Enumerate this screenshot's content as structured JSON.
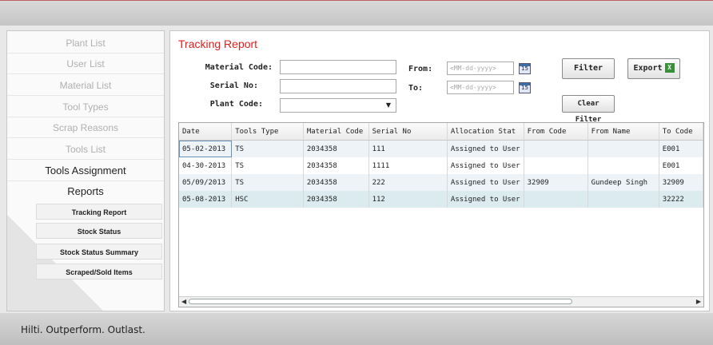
{
  "footer": {
    "tagline": "Hilti. Outperform. Outlast."
  },
  "sidebar": {
    "items": [
      {
        "label": "Plant List"
      },
      {
        "label": "User List"
      },
      {
        "label": "Material List"
      },
      {
        "label": "Tool Types"
      },
      {
        "label": "Scrap Reasons"
      },
      {
        "label": "Tools List"
      },
      {
        "label": "Tools Assignment"
      },
      {
        "label": "Reports"
      }
    ],
    "sub_items": [
      {
        "label": "Tracking Report"
      },
      {
        "label": "Stock Status"
      },
      {
        "label": "Stock Status Summary"
      },
      {
        "label": "Scraped/Sold Items"
      }
    ]
  },
  "main": {
    "title": "Tracking Report",
    "form": {
      "material_code_label": "Material Code:",
      "serial_no_label": "Serial No:",
      "plant_code_label": "Plant Code:",
      "from_label": "From:",
      "to_label": "To:",
      "from_placeholder": "<MM-dd-yyyy>",
      "to_placeholder": "<MM-dd-yyyy>",
      "calendar_day": "15"
    },
    "buttons": {
      "filter": "Filter",
      "export": "Export",
      "clear_filter": "Clear Filter"
    },
    "grid": {
      "columns": [
        "Date",
        "Tools Type",
        "Material Code",
        "Serial No",
        "Allocation Stat",
        "From Code",
        "From Name",
        "To Code"
      ],
      "rows": [
        [
          "05-02-2013",
          "TS",
          "2034358",
          "111",
          "Assigned to User",
          "",
          "",
          "E001"
        ],
        [
          "04-30-2013",
          "TS",
          "2034358",
          "1111",
          "Assigned to User",
          "",
          "",
          "E001"
        ],
        [
          "05/09/2013",
          "TS",
          "2034358",
          "222",
          "Assigned to User",
          "32909",
          "Gundeep Singh",
          "32909"
        ],
        [
          "05-08-2013",
          "HSC",
          "2034358",
          "112",
          "Assigned to User",
          "",
          "",
          "32222"
        ]
      ]
    }
  },
  "icons": {
    "calendar": "calendar-icon",
    "excel": "excel-icon",
    "dropdown": "chevron-down-icon"
  }
}
